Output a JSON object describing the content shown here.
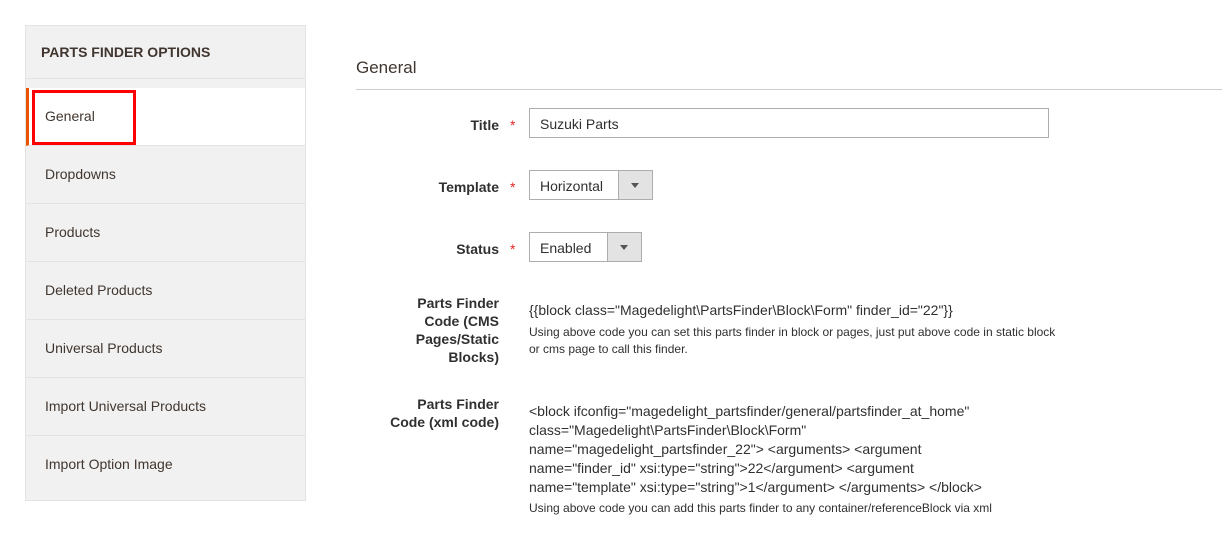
{
  "sidebar": {
    "title": "PARTS FINDER OPTIONS",
    "items": [
      {
        "label": "General"
      },
      {
        "label": "Dropdowns"
      },
      {
        "label": "Products"
      },
      {
        "label": "Deleted Products"
      },
      {
        "label": "Universal Products"
      },
      {
        "label": "Import Universal Products"
      },
      {
        "label": "Import Option Image"
      }
    ],
    "active": "General",
    "highlight_color": "#ff0000"
  },
  "main": {
    "section_title": "General",
    "fields": {
      "title": {
        "label": "Title",
        "value": "Suzuki Parts",
        "required": true
      },
      "template": {
        "label": "Template",
        "value": "Horizontal",
        "required": true
      },
      "status": {
        "label": "Status",
        "value": "Enabled",
        "required": true
      },
      "cms_code": {
        "label": "Parts Finder Code (CMS Pages/Static Blocks)",
        "value": "{{block class=\"Magedelight\\PartsFinder\\Block\\Form\" finder_id=\"22\"}}",
        "note": "Using above code you can set this parts finder in block or pages, just put above code in static block or cms page to call this finder."
      },
      "xml_code": {
        "label": "Parts Finder Code (xml code)",
        "value": "<block ifconfig=\"magedelight_partsfinder/general/partsfinder_at_home\" class=\"Magedelight\\PartsFinder\\Block\\Form\" name=\"magedelight_partsfinder_22\"> <arguments> <argument name=\"finder_id\" xsi:type=\"string\">22</argument> <argument name=\"template\" xsi:type=\"string\">1</argument> </arguments> </block>",
        "note": "Using above code you can add this parts finder to any container/referenceBlock via xml"
      }
    },
    "required_mark": "*"
  }
}
